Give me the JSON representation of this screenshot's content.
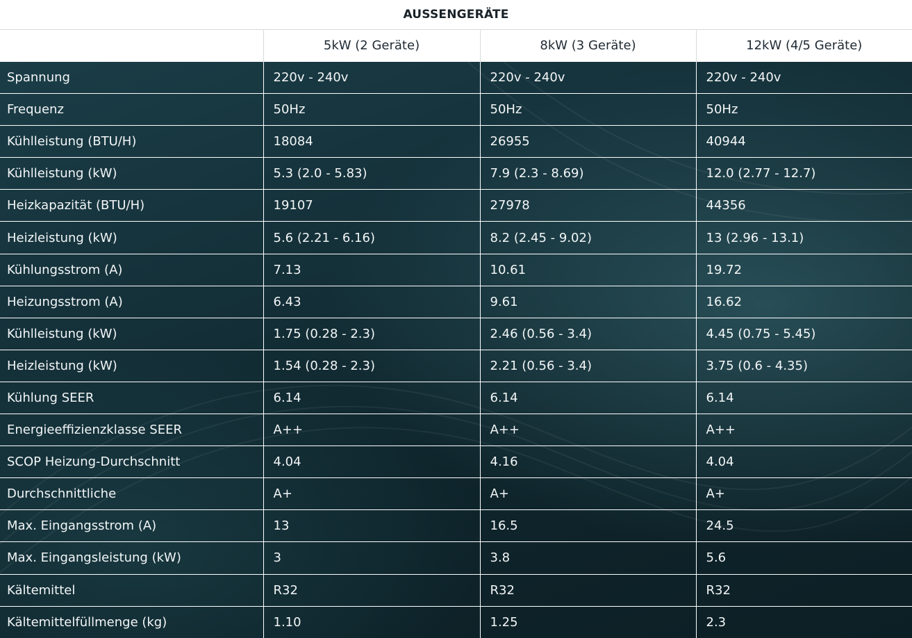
{
  "title": "AUSSENGERÄTE",
  "columns": [
    "",
    "5kW (2 Geräte)",
    "8kW (3 Geräte)",
    "12kW (4/5 Geräte)"
  ],
  "rows": [
    [
      "Spannung",
      "220v - 240v",
      "220v - 240v",
      "220v - 240v"
    ],
    [
      "Frequenz",
      "50Hz",
      "50Hz",
      "50Hz"
    ],
    [
      "Kühlleistung (BTU/H)",
      "18084",
      "26955",
      "40944"
    ],
    [
      "Kühlleistung (kW)",
      "5.3 (2.0 - 5.83)",
      "7.9 (2.3 - 8.69)",
      "12.0 (2.77 - 12.7)"
    ],
    [
      "Heizkapazität (BTU/H)",
      "19107",
      "27978",
      "44356"
    ],
    [
      "Heizleistung (kW)",
      "5.6 (2.21 - 6.16)",
      "8.2 (2.45 - 9.02)",
      "13 (2.96 - 13.1)"
    ],
    [
      "Kühlungsstrom (A)",
      "7.13",
      "10.61",
      "19.72"
    ],
    [
      "Heizungsstrom (A)",
      "6.43",
      "9.61",
      "16.62"
    ],
    [
      "Kühlleistung (kW)",
      "1.75 (0.28 - 2.3)",
      "2.46 (0.56 - 3.4)",
      "4.45 (0.75 - 5.45)"
    ],
    [
      "Heizleistung (kW)",
      "1.54 (0.28 - 2.3)",
      "2.21 (0.56 - 3.4)",
      "3.75 (0.6 - 4.35)"
    ],
    [
      "Kühlung SEER",
      "6.14",
      "6.14",
      "6.14"
    ],
    [
      "Energieeffizienzklasse SEER",
      "A++",
      "A++",
      "A++"
    ],
    [
      "SCOP Heizung-Durchschnitt",
      "4.04",
      "4.16",
      "4.04"
    ],
    [
      "Durchschnittliche",
      "A+",
      "A+",
      "A+"
    ],
    [
      "Max. Eingangsstrom (A)",
      "13",
      "16.5",
      "24.5"
    ],
    [
      "Max. Eingangsleistung (kW)",
      "3",
      "3.8",
      "5.6"
    ],
    [
      "Kältemittel",
      "R32",
      "R32",
      "R32"
    ],
    [
      "Kältemittelfüllmenge (kg)",
      "1.10",
      "1.25",
      "2.3"
    ]
  ]
}
